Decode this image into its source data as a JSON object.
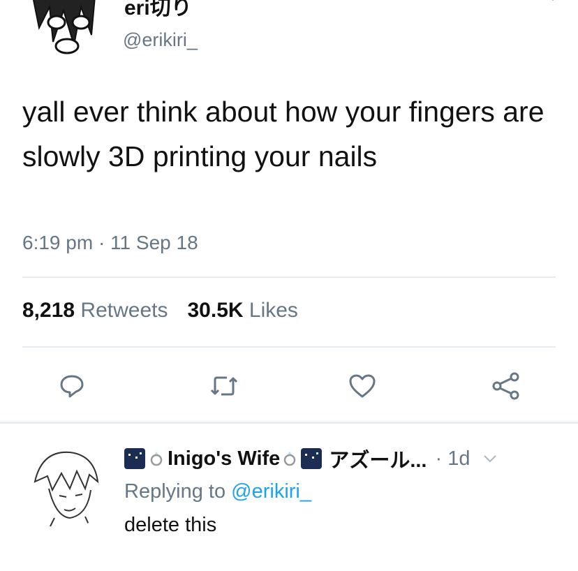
{
  "tweet": {
    "display_name": "eri切り",
    "handle": "@erikiri_",
    "text": "yall ever think about how your fingers are slowly 3D printing your nails",
    "timestamp": "6:19 pm · 11 Sep 18",
    "retweets_count": "8,218",
    "retweets_label": "Retweets",
    "likes_count": "30.5K",
    "likes_label": "Likes",
    "actions": [
      {
        "icon": "reply-icon"
      },
      {
        "icon": "retweet-icon"
      },
      {
        "icon": "heart-icon"
      },
      {
        "icon": "share-icon"
      }
    ]
  },
  "reply": {
    "display_name": "Inigo's Wife",
    "name_suffix": "アズール...",
    "time": "· 1d",
    "replying_prefix": "Replying to",
    "replying_handle": "@erikiri_",
    "text": "delete this"
  },
  "colors": {
    "text": "#14171a",
    "secondary": "#657786",
    "link": "#1da1f2",
    "divider": "#e6ecf0"
  }
}
